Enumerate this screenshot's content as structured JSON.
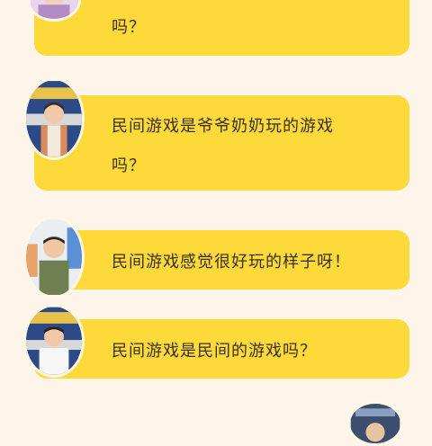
{
  "messages": [
    {
      "lines": [
        "吗？"
      ]
    },
    {
      "lines": [
        "民间游戏是爷爷奶奶玩的游戏",
        "吗？"
      ]
    },
    {
      "lines": [
        "民间游戏感觉很好玩的样子呀！"
      ]
    },
    {
      "lines": [
        "民间游戏是民间的游戏吗？"
      ]
    }
  ],
  "colors": {
    "bubble": "#fdd93a",
    "background": "#fdf5ea",
    "text": "#3a3020"
  }
}
